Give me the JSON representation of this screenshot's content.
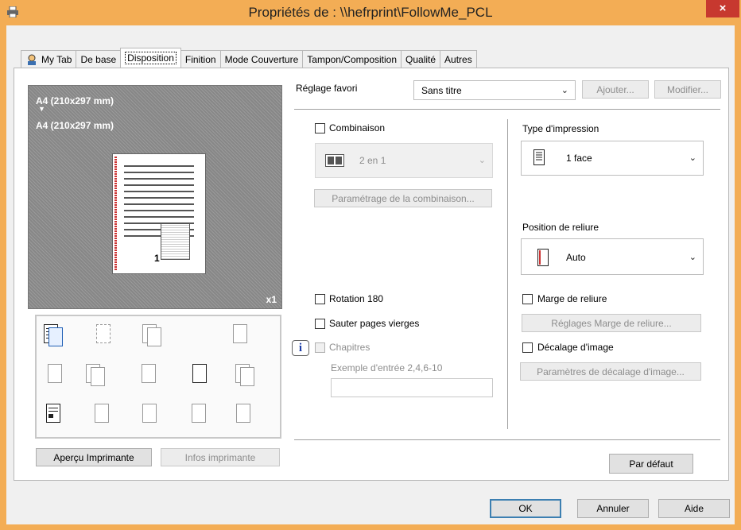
{
  "window": {
    "title": "Propriétés de : \\\\hefrprint\\FollowMe_PCL",
    "close": "×"
  },
  "tabs": [
    "My Tab",
    "De base",
    "Disposition",
    "Finition",
    "Mode Couverture",
    "Tampon/Composition",
    "Qualité",
    "Autres"
  ],
  "preview": {
    "line1": "A4 (210x297 mm)",
    "arrow": "▼",
    "line2": "A4 (210x297 mm)",
    "page_number": "1",
    "copies": "x1"
  },
  "left_buttons": {
    "apercu": "Aperçu Imprimante",
    "infos": "Infos imprimante"
  },
  "favori": {
    "label": "Réglage favori",
    "value": "Sans titre",
    "ajouter": "Ajouter...",
    "modifier": "Modifier..."
  },
  "combinaison": {
    "label": "Combinaison",
    "value": "2 en 1",
    "param_button": "Paramétrage de la combinaison..."
  },
  "rotation": "Rotation 180",
  "sauter": "Sauter pages vierges",
  "chapitres": {
    "label": "Chapitres",
    "info_icon": "i",
    "example": "Exemple d'entrée 2,4,6-10",
    "value": ""
  },
  "type_impression": {
    "label": "Type d'impression",
    "value": "1 face"
  },
  "position_reliure": {
    "label": "Position de reliure",
    "value": "Auto"
  },
  "marge": {
    "label": "Marge de reliure",
    "button": "Réglages Marge de reliure..."
  },
  "decalage": {
    "label": "Décalage d'image",
    "button": "Paramètres de décalage d'image..."
  },
  "par_defaut": "Par défaut",
  "footer": {
    "ok": "OK",
    "annuler": "Annuler",
    "aide": "Aide"
  },
  "colors": {
    "title_bar": "#f3ad55",
    "close_button": "#c7382f",
    "default_button_border": "#3c7fb1"
  }
}
